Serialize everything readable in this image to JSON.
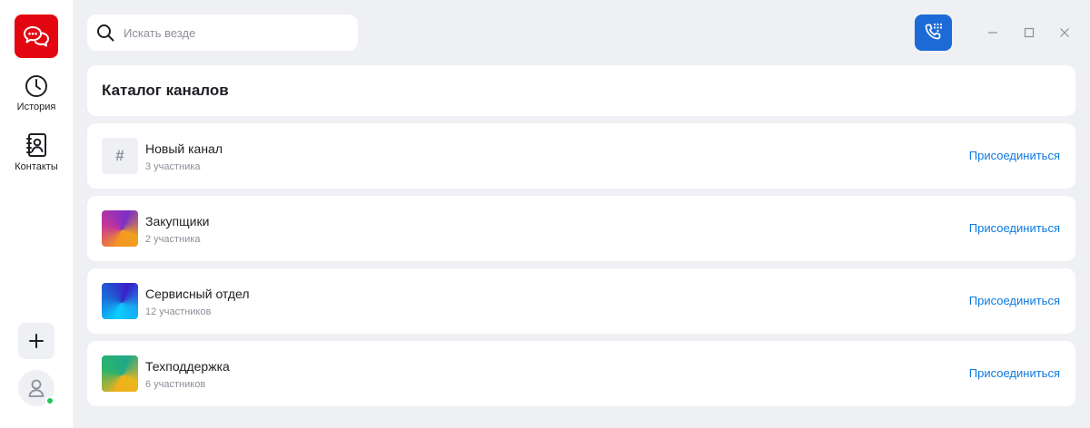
{
  "sidebar": {
    "logo_icon": "chat-bubbles-icon",
    "brand_color": "#e30611",
    "items": [
      {
        "label": "История",
        "icon": "clock-icon"
      },
      {
        "label": "Контакты",
        "icon": "contacts-book-icon"
      }
    ],
    "add_icon": "plus-icon",
    "avatar_icon": "user-icon",
    "presence_status": "online",
    "presence_color": "#23c55e"
  },
  "search": {
    "placeholder": "Искать везде",
    "value": ""
  },
  "toolbar": {
    "call_icon": "phone-dialpad-icon",
    "accent_color": "#1c6ad6"
  },
  "window_controls": [
    "minimize-icon",
    "maximize-icon",
    "close-icon"
  ],
  "catalog": {
    "title": "Каталог каналов",
    "join_color": "#0d7ae0",
    "channels": [
      {
        "name": "Новый канал",
        "members": "3 участника",
        "icon": "hash-icon",
        "icon_text": "#",
        "join_label": "Присоединиться"
      },
      {
        "name": "Закупщики",
        "members": "2 участника",
        "icon": "gradient-avatar",
        "join_label": "Присоединиться"
      },
      {
        "name": "Сервисный отдел",
        "members": "12 участников",
        "icon": "gradient-avatar",
        "join_label": "Присоединиться"
      },
      {
        "name": "Техподдержка",
        "members": "6 участников",
        "icon": "gradient-avatar",
        "join_label": "Присоединиться"
      }
    ]
  }
}
